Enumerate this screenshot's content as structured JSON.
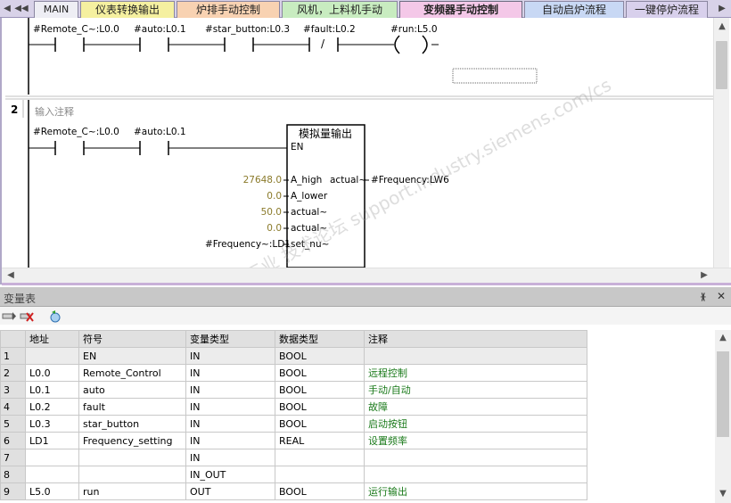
{
  "tabs": [
    {
      "label": "MAIN"
    },
    {
      "label": "仪表转换输出"
    },
    {
      "label": "炉排手动控制"
    },
    {
      "label": "风机，上料机手动"
    },
    {
      "label": "变频器手动控制"
    },
    {
      "label": "自动启炉流程"
    },
    {
      "label": "一键停炉流程"
    }
  ],
  "editor": {
    "network1": {
      "contacts": [
        "#Remote_C~:L0.0",
        "#auto:L0.1",
        "#star_button:L0.3",
        "#fault:L0.2"
      ],
      "nc_symbol": "/",
      "coil": "#run:L5.0"
    },
    "network2": {
      "number": "2",
      "comment": "输入注释",
      "contacts": [
        "#Remote_C~:L0.0",
        "#auto:L0.1"
      ],
      "block_title": "模拟量输出",
      "en": "EN",
      "inputs": [
        {
          "value": "27648.0",
          "pin": "A_high"
        },
        {
          "value": "0.0",
          "pin": "A_lower"
        },
        {
          "value": "50.0",
          "pin": "actual~"
        },
        {
          "value": "0.0",
          "pin": "actual~"
        },
        {
          "value": "#Frequency~:LD1",
          "pin": "set_nu~"
        }
      ],
      "output_pin": "actual~",
      "output_value": "#Frequency:LW6"
    },
    "watermark": "西门子工业 技术论坛 support.industry.siemens.com/cs"
  },
  "var_panel": {
    "title": "变量表",
    "headers": [
      "地址",
      "符号",
      "变量类型",
      "数据类型",
      "注释"
    ],
    "rows": [
      {
        "n": "1",
        "addr": "",
        "sym": "EN",
        "vtype": "IN",
        "dtype": "BOOL",
        "comment": ""
      },
      {
        "n": "2",
        "addr": "L0.0",
        "sym": "Remote_Control",
        "vtype": "IN",
        "dtype": "BOOL",
        "comment": "远程控制"
      },
      {
        "n": "3",
        "addr": "L0.1",
        "sym": "auto",
        "vtype": "IN",
        "dtype": "BOOL",
        "comment": "手动/自动"
      },
      {
        "n": "4",
        "addr": "L0.2",
        "sym": "fault",
        "vtype": "IN",
        "dtype": "BOOL",
        "comment": "故障"
      },
      {
        "n": "5",
        "addr": "L0.3",
        "sym": "star_button",
        "vtype": "IN",
        "dtype": "BOOL",
        "comment": "启动按钮"
      },
      {
        "n": "6",
        "addr": "LD1",
        "sym": "Frequency_setting",
        "vtype": "IN",
        "dtype": "REAL",
        "comment": "设置频率"
      },
      {
        "n": "7",
        "addr": "",
        "sym": "",
        "vtype": "IN",
        "dtype": "",
        "comment": ""
      },
      {
        "n": "8",
        "addr": "",
        "sym": "",
        "vtype": "IN_OUT",
        "dtype": "",
        "comment": ""
      },
      {
        "n": "9",
        "addr": "L5.0",
        "sym": "run",
        "vtype": "OUT",
        "dtype": "BOOL",
        "comment": "运行输出"
      }
    ]
  },
  "colors": {
    "tab_active": "#f4c8e8",
    "comment_green": "#1a7a1a",
    "value_olive": "#8a7a2a"
  }
}
